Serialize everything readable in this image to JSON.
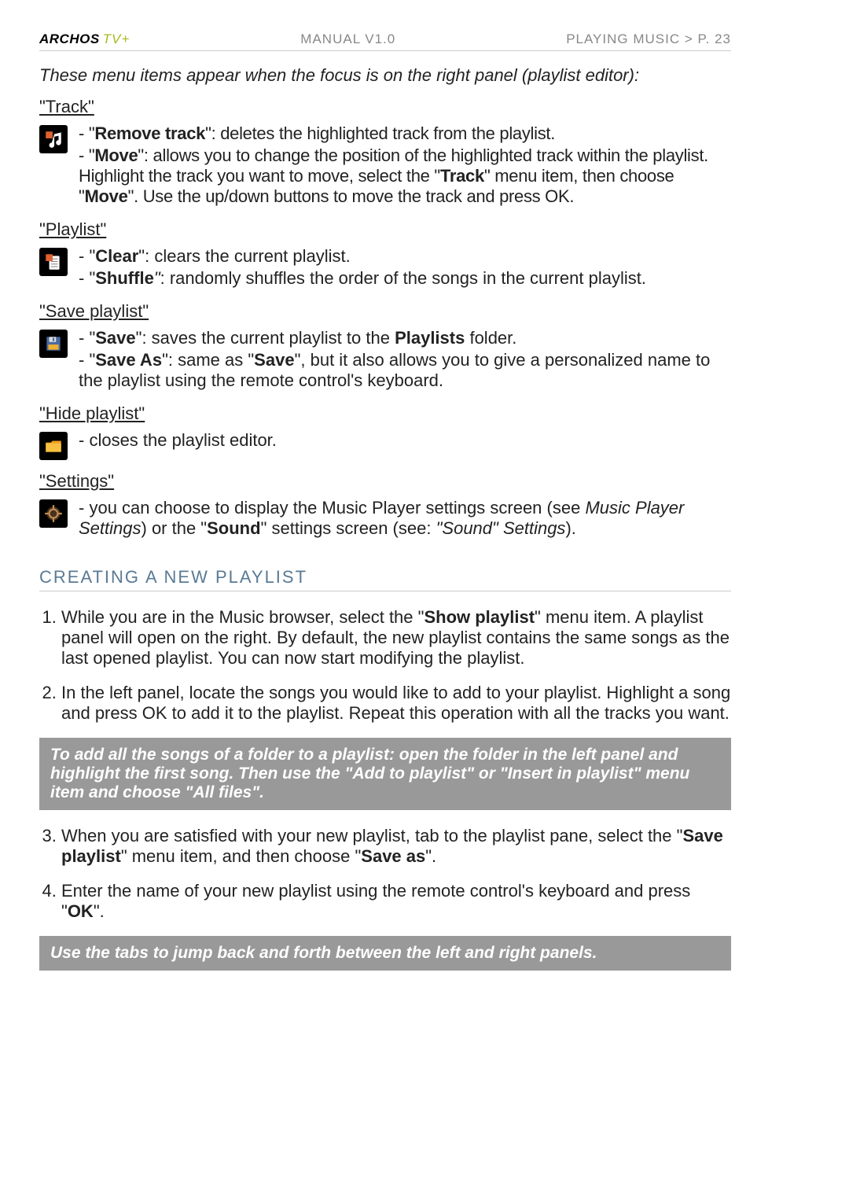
{
  "header": {
    "brand_main": "ARCHOS",
    "brand_suffix": "TV+",
    "manual": "MANUAL V1.0",
    "breadcrumb": "PLAYING MUSIC   >   P. 23"
  },
  "intro": "These menu items appear when the focus is on the right panel (playlist editor):",
  "sections": {
    "track": {
      "label": "\"Track\"",
      "items": [
        {
          "name": "Remove track",
          "text": ": deletes the highlighted track from the playlist."
        }
      ],
      "move_name": "Move",
      "move_a": ": allows you to change the position of the highlighted track within the playlist. Highlight the track you want to move, select the \"",
      "move_b": "Track",
      "move_c": "\" menu item, then choose \"",
      "move_d": "Move",
      "move_e": "\". Use the up/down buttons to move the track and press OK."
    },
    "playlist": {
      "label": "\"Playlist\"",
      "clear_name": "Clear",
      "clear_text": ": clears the current playlist.",
      "shuffle_name": "Shuffle",
      "shuffle_text": ": randomly shuffles the order of the songs in the current playlist."
    },
    "save": {
      "label": "\"Save playlist\"",
      "save_name": "Save",
      "save_a": ": saves the current playlist to the ",
      "save_b": "Playlists",
      "save_c": " folder.",
      "saveas_name": "Save As",
      "saveas_a": ": same as \"",
      "saveas_b": "Save",
      "saveas_c": "\", but it also allows you to give a personalized name to the playlist using the remote control's keyboard."
    },
    "hide": {
      "label": "\"Hide playlist\"",
      "text": "closes the playlist editor."
    },
    "settings": {
      "label": "\"Settings\"",
      "a": "you can choose to display the Music Player settings screen (see ",
      "b": "Music Player Settings",
      "c": ") or the \"",
      "d": "Sound",
      "e": "\" settings screen (see: ",
      "f": "\"Sound\" Settings",
      "g": ")."
    }
  },
  "create": {
    "heading": "CREATING A NEW PLAYLIST",
    "step1a": "While you are in the Music browser, select the \"",
    "step1b": "Show playlist",
    "step1c": "\" menu item. A playlist panel will open on the right. By default, the new playlist contains the same songs as the last opened playlist. You can now start modifying the playlist.",
    "step2": "In the left panel, locate the songs you would like to add to your playlist. Highlight a song and press OK to add it to the playlist. Repeat this operation with all the tracks you want.",
    "tip1": "To add all the songs of a folder to a playlist: open the folder in the left panel and highlight the first song. Then use the \"Add to playlist\" or \"Insert in playlist\" menu item and choose \"All files\".",
    "step3a": "When you are satisfied with your new playlist, tab to the playlist pane, select the \"",
    "step3b": "Save playlist",
    "step3c": "\" menu item, and then choose \"",
    "step3d": "Save as",
    "step3e": "\".",
    "step4a": "Enter the name of your new playlist using the remote control's keyboard and press \"",
    "step4b": "OK",
    "step4c": "\".",
    "tip2": "Use the tabs to jump back and forth between the left and right panels."
  }
}
